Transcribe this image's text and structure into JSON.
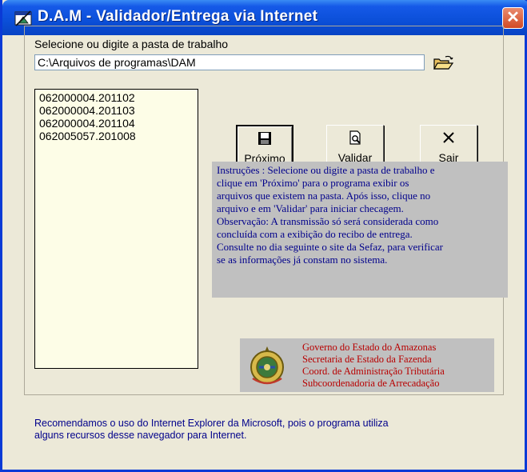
{
  "window": {
    "title": "D.A.M - Validador/Entrega via  Internet",
    "close_label": "✕"
  },
  "folder": {
    "label": "Selecione ou digite a pasta de trabalho",
    "value": "C:\\Arquivos de programas\\DAM"
  },
  "files": [
    "062000004.201102",
    "062000004.201103",
    "062000004.201104",
    "062005057.201008"
  ],
  "buttons": {
    "next_label": "Próximo",
    "validate_label": "Validar",
    "exit_label": "Sair"
  },
  "instructions": {
    "lines": [
      "Instruções : Selecione ou digite a pasta de trabalho e",
      "clique em  'Próximo' para o programa exibir os",
      "arquivos que existem na pasta. Após isso, clique no",
      "arquivo e  em 'Validar' para iniciar checagem.",
      "Observação: A transmissão só será considerada como",
      "concluída com a exibição do recibo de entrega.",
      "Consulte no dia seguinte o site da Sefaz, para verificar",
      "se as informações já constam no sistema."
    ]
  },
  "government": {
    "lines": [
      "Governo do Estado do Amazonas",
      "Secretaria de Estado da Fazenda",
      "Coord. de Administração Tributária",
      "Subcoordenadoria de Arrecadação"
    ]
  },
  "footer": {
    "lines": [
      "Recomendamos o uso do Internet Explorer da Microsoft, pois o programa utiliza",
      "alguns recursos desse  navegador  para  Internet."
    ]
  },
  "colors": {
    "titlebar": "#0b4fd8",
    "window_bg": "#ece9d8",
    "list_bg": "#fdfde7",
    "instructions_text": "#00008b",
    "government_text": "#b80000"
  }
}
